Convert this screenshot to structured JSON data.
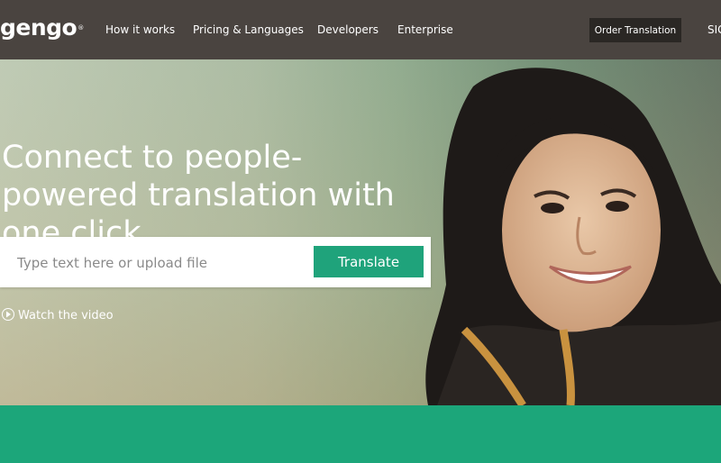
{
  "header": {
    "logo": "gengo",
    "logo_mark": "®",
    "nav": [
      "How it works",
      "Pricing & Languages",
      "Developers",
      "Enterprise"
    ],
    "order_button": "Order Translation",
    "signin": "SIG"
  },
  "hero": {
    "headline": "Connect to people-powered translation with one click.",
    "search": {
      "placeholder": "Type text here or upload file",
      "value": ""
    },
    "translate_button": "Translate",
    "watch_video": "Watch the video"
  },
  "colors": {
    "topbar": "#4a4440",
    "accent_green": "#1fa37b",
    "band_green": "#1ca67a",
    "order_button_bg": "#2a2724"
  },
  "icons": [
    "play-circle-icon"
  ]
}
